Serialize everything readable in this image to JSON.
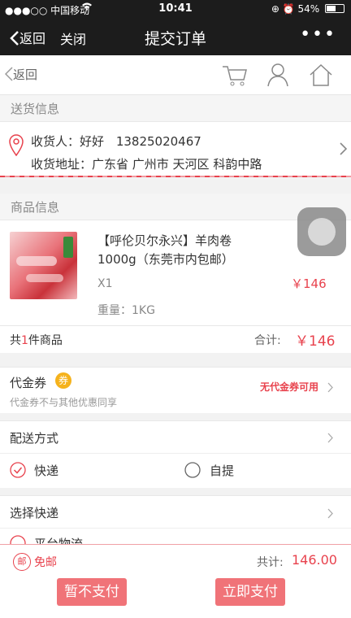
{
  "status": {
    "carrier": "●●●○○ 中国移动",
    "time": "10:41",
    "battery": "54%"
  },
  "nav": {
    "back": "返回",
    "close": "关闭",
    "title": "提交订单",
    "more": "•••"
  },
  "toolbar": {
    "back": "返回"
  },
  "shipping": {
    "header": "送货信息",
    "recipient_label": "收货人：",
    "recipient_name": "好好",
    "phone": "13825020467",
    "address_label": "收货地址：",
    "address": "广东省 广州市 天河区 科韵中路"
  },
  "goods": {
    "header": "商品信息",
    "name": "【呼伦贝尔永兴】羊肉卷 1000g（东莞市内包邮）",
    "qty": "X1",
    "price": "￥146",
    "weight": "重量：1KG",
    "count_prefix": "共",
    "count": "1",
    "count_suffix": "件商品",
    "total_label": "合计:",
    "total": "￥146"
  },
  "voucher": {
    "label": "代金券",
    "badge": "券",
    "note": "代金券不与其他优惠同享",
    "status": "无代金券可用"
  },
  "delivery": {
    "label": "配送方式",
    "option1": "快递",
    "option2": "自提",
    "select_express": "选择快递",
    "partial": "平台物流"
  },
  "footer": {
    "badge": "邮",
    "free_shipping": "免邮",
    "total_label": "共计:",
    "total": "146.00",
    "btn_later": "暂不支付",
    "btn_now": "立即支付"
  },
  "colors": {
    "accent": "#e8424d",
    "button": "#f07378",
    "dark": "#1c1c1c"
  }
}
